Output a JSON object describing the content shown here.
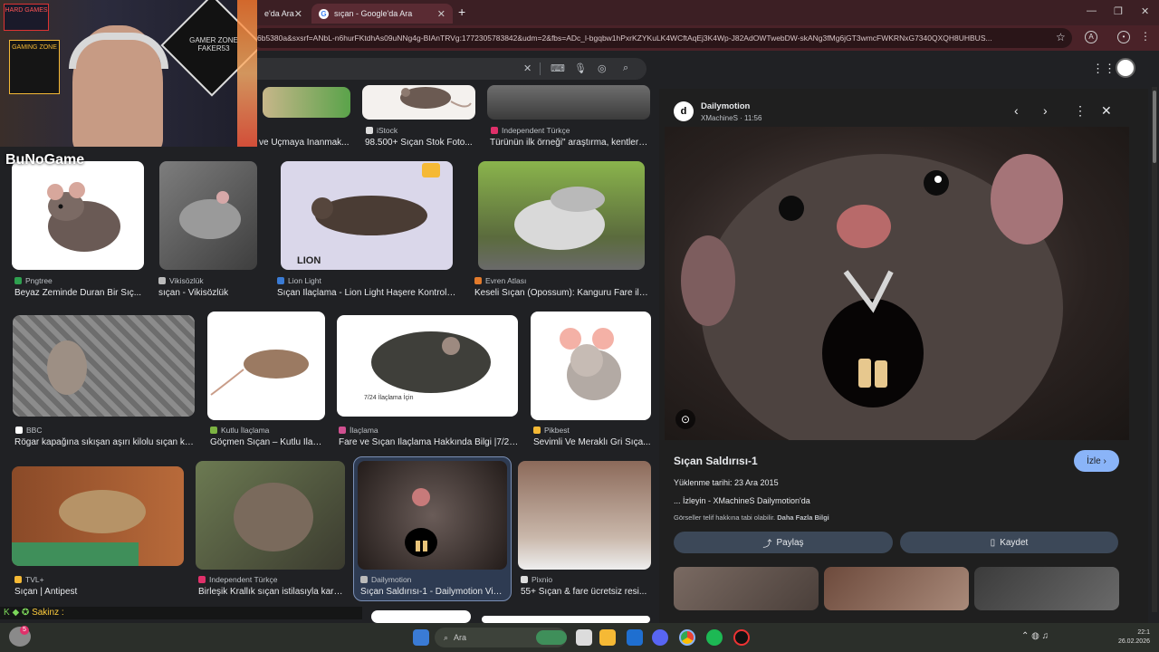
{
  "browser": {
    "tabs": [
      {
        "label": "e'da Ara"
      },
      {
        "label": "sıçan - Google'da Ara"
      }
    ],
    "url": "6b5380a&sxsrf=ANbL-n6hurFKtdhAs09uNNg4g-BIAnTRVg:1772305783842&udm=2&fbs=ADc_l-bgqbw1hPxrKZYKuLK4WCftAqEj3K4Wp-J82AdOWTwebDW-skANg3fMg6jGT3wmcFWKRNxG7340QXQH8UHBUS..."
  },
  "images": {
    "top_row": [
      {
        "source": "",
        "caption": "ve Uçmaya İnanmak..."
      },
      {
        "source": "iStock",
        "caption": "98.500+ Sıçan Stok Foto..."
      },
      {
        "source": "Independent Türkçe",
        "caption": "Türünün ilk örneği\" araştırma, kentlerd..."
      }
    ],
    "row1": [
      {
        "source": "Pngtree",
        "caption": "Beyaz Zeminde Duran Bir Sıç...",
        "color": "#2ea04f"
      },
      {
        "source": "Vikisözlük",
        "caption": "sıçan - Vikisözlük",
        "color": "#bbbbbb"
      },
      {
        "source": "Lion Light",
        "caption": "Sıçan İlaçlama - Lion Light Haşere Kontrol H...",
        "color": "#3a7bd5"
      },
      {
        "source": "Evren Atlası",
        "caption": "Keseli Sıçan (Opossum): Kanguru Fare ile ...",
        "color": "#e37b2c"
      }
    ],
    "row2": [
      {
        "source": "BBC",
        "caption": "Rögar kapağına sıkışan aşırı kilolu sıçan ku...",
        "color": "#ffffff"
      },
      {
        "source": "Kutlu İlaçlama",
        "caption": "Göçmen Sıçan – Kutlu İlaç...",
        "color": "#7cb342"
      },
      {
        "source": "İlaçlama",
        "caption": "Fare ve Sıçan İlaçlama Hakkında Bilgi |7/24...",
        "color": "#d05090"
      },
      {
        "source": "Pikbest",
        "caption": "Sevimli Ve Meraklı Gri Sıça...",
        "color": "#f5b935"
      }
    ],
    "row3": [
      {
        "source": "TVL+",
        "caption": "Sıçan | Antipest",
        "color": "#f5b935"
      },
      {
        "source": "Independent Türkçe",
        "caption": "Birleşik Krallık sıçan istilasıyla karş...",
        "color": "#e0306a"
      },
      {
        "source": "Dailymotion",
        "caption": "Sıçan Saldırısı-1 - Dailymotion Video",
        "color": "#bbbbbb"
      },
      {
        "source": "Pixnio",
        "caption": "55+ Sıçan & fare ücretsiz resi...",
        "color": "#dddddd"
      }
    ],
    "image_texts": {
      "lion_watermark": "LION",
      "ilaclama_watermark": "7/24 İlaçlama İçin"
    }
  },
  "panel": {
    "site": "Dailymotion",
    "channel": "XMachineS · 11:56",
    "title": "Sıçan Saldırısı-1",
    "upload": "Yüklenme tarihi: 23 Ara 2015",
    "desc": "... İzleyin - XMachineS Dailymotion'da",
    "rights_prefix": "Görseller telif hakkına tabi olabilir.",
    "rights_link": "Daha Fazla Bilgi",
    "watch_label": "İzle",
    "share_label": "Paylaş",
    "save_label": "Kaydet"
  },
  "overlay": {
    "brand": "BuNoGame",
    "chat": "Sakinz :",
    "wall_signs": [
      "HARD GAMES",
      "GAMER ZONE FAKER53",
      "GAMING ZONE"
    ]
  },
  "taskbar": {
    "search_label": "Ara",
    "badge": "5",
    "clock_time": "22:1",
    "clock_date": "26.02.2026"
  }
}
